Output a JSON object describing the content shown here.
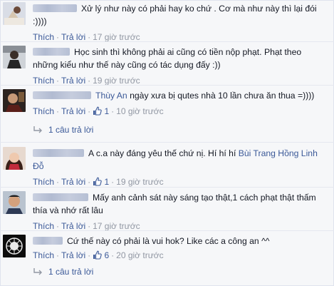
{
  "labels": {
    "like": "Thích",
    "reply": "Trả lời",
    "sep": "·"
  },
  "comments": [
    {
      "text_1": "Xử lý như này có phải hay ko chứ . Cơ mà như này thì lại đói",
      "text_2": ":))))",
      "time": "17 giờ trước"
    },
    {
      "text_1": "Học sinh thì không phải ai cũng có tiền nộp phạt. Phạt theo",
      "text_2": "những kiểu như thế này cũng có tác dụng đấy :))",
      "time": "19 giờ trước"
    },
    {
      "tag": "Thùy An",
      "text_1": " ngày xưa bị qutes nhà 10 lần chưa ăn thua =))))",
      "likes": "1",
      "time": "10 giờ trước",
      "replies": "1 câu trả lời"
    },
    {
      "text_1": "A c.a này đáng yêu thế chứ nị. Hí hí hí ",
      "tag": "Bùi Trang Hồng Linh",
      "text_2": "Đỗ",
      "likes": "1",
      "time": "19 giờ trước"
    },
    {
      "text_1": "Mấy anh cảnh sát này sáng tạo thật,1 cách phạt thật thấm",
      "text_2": "thía và nhớ rất lâu",
      "time": "17 giờ trước"
    },
    {
      "text_1": "Cứ thế này có phải là vui hok? Like các a công an ^^",
      "likes": "6",
      "time": "20 giờ trước",
      "replies": "1 câu trả lời"
    }
  ],
  "colors": {
    "link": "#3b5998",
    "meta": "#9197a3",
    "text": "#141823",
    "background": "#f6f7f9"
  },
  "icons": {
    "like": "thumbs-up-icon",
    "reply": "reply-arrow-icon"
  }
}
